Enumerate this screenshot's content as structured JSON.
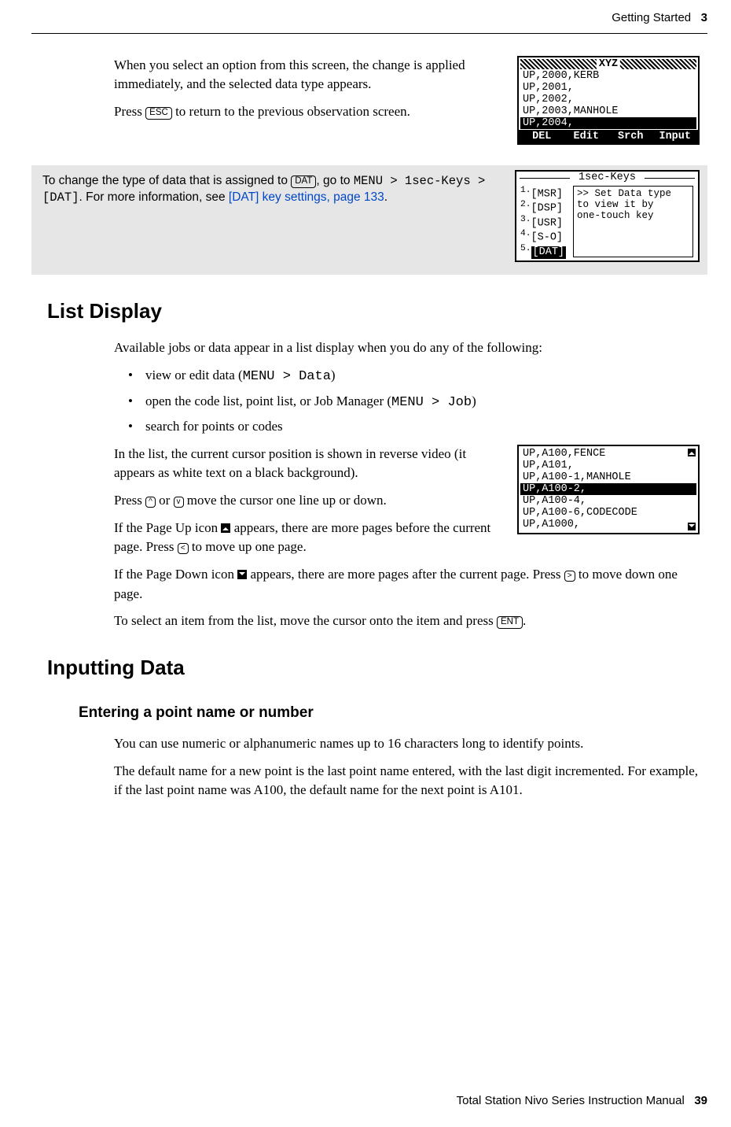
{
  "header": {
    "section": "Getting Started",
    "chapter_num": "3"
  },
  "intro": {
    "p1": "When you select an option from this screen, the change is applied immediately, and the selected data type appears.",
    "p2_a": "Press ",
    "p2_key": "ESC",
    "p2_b": " to return to the previous observation screen."
  },
  "screen1": {
    "title": "XYZ",
    "rows": [
      "UP,2000,KERB",
      "UP,2001,",
      "UP,2002,",
      "UP,2003,MANHOLE"
    ],
    "row_sel": "UP,2004,",
    "softkeys": [
      "DEL",
      "Edit",
      "Srch",
      "Input"
    ]
  },
  "tip": {
    "t1": "To change the type of data that is assigned to ",
    "key": "DAT",
    "t2": ", go to ",
    "path1": "MENU > 1sec-Keys > [DAT]",
    "t3": ". For more information, see ",
    "link": "[DAT] key settings, page 133",
    "t4": "."
  },
  "screen2": {
    "title": "1sec-Keys",
    "items": [
      "[MSR]",
      "[DSP]",
      "[USR]",
      "[S-O]"
    ],
    "item_sel": "[DAT]",
    "hint": [
      ">> Set Data type",
      "to view it by",
      "one-touch key"
    ]
  },
  "listdisplay": {
    "heading": "List Display",
    "intro": "Available jobs or data appear in a list display when you do any of the following:",
    "b1a": "view or edit data (",
    "b1m": "MENU > Data",
    "b1b": ")",
    "b2a": "open the code list, point list, or Job Manager (",
    "b2m": "MENU > Job",
    "b2b": ")",
    "b3": "search for points or codes",
    "p1": "In the list, the current cursor position is shown in reverse video (it appears as white text on a black background).",
    "p2a": "Press ",
    "p2k1": "^",
    "p2b": " or ",
    "p2k2": "v",
    "p2c": " move the cursor one line up or down.",
    "p3a": "If the Page Up icon ",
    "p3b": " appears, there are more pages before the current page. Press ",
    "p3k": "<",
    "p3c": " to move up one page.",
    "p4a": "If the Page Down icon ",
    "p4b": " appears, there are more pages after the current page. Press ",
    "p4k": ">",
    "p4c": " to move down one page.",
    "p5a": "To select an item from the list, move the cursor onto the item and press ",
    "p5k": "ENT",
    "p5b": "."
  },
  "screen3": {
    "rows_pre": [
      "UP,A100,FENCE",
      "UP,A101,",
      "UP,A100-1,MANHOLE"
    ],
    "row_sel": "UP,A100-2,",
    "rows_post": [
      "UP,A100-4,",
      "UP,A100-6,CODECODE",
      "UP,A1000,"
    ]
  },
  "inputting": {
    "heading": "Inputting Data",
    "sub": "Entering a point name or number",
    "p1": "You can use numeric or alphanumeric names up to 16 characters long to identify points.",
    "p2": "The default name for a new point is the last point name entered, with the last digit incremented. For example, if the last point name was A100, the default name for the next point is A101."
  },
  "footer": {
    "title": "Total Station Nivo Series Instruction Manual",
    "page": "39"
  }
}
